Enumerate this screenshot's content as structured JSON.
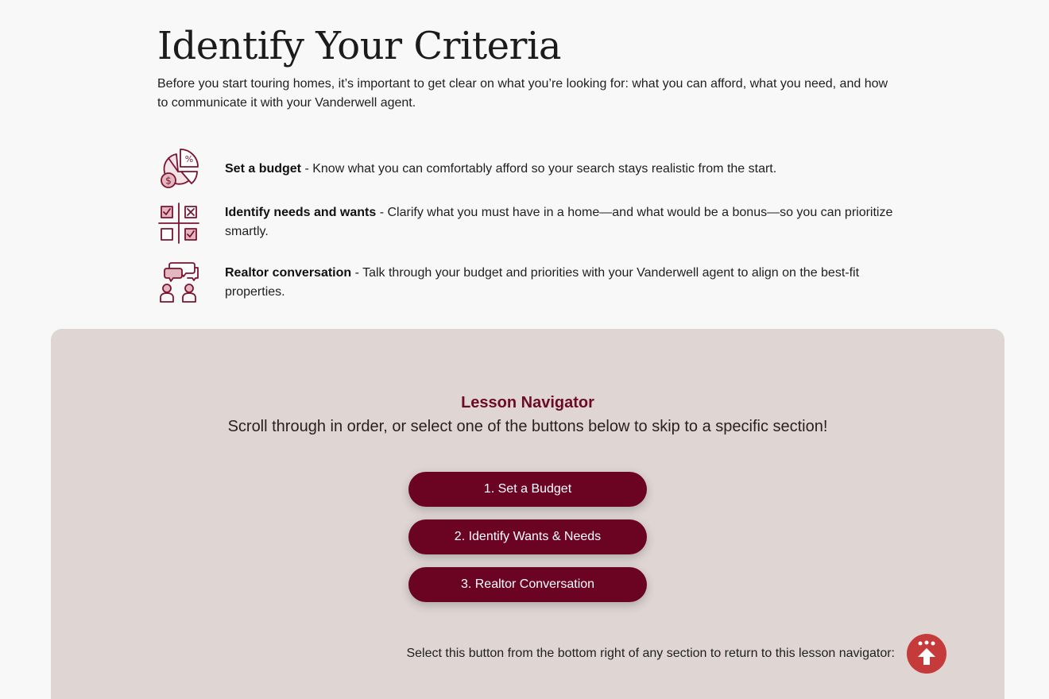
{
  "header": {
    "title": "Identify Your Criteria",
    "intro": "Before you start touring homes, it’s important to get clear on what you’re looking for: what you can afford, what you need, and how to communicate it with your Vanderwell agent."
  },
  "criteria": [
    {
      "icon": "budget-pie-chart-icon",
      "title": "Set a budget",
      "description": " - Know what you can comfortably afford so your search stays realistic from the start."
    },
    {
      "icon": "needs-wants-checklist-icon",
      "title": "Identify needs and wants",
      "description": " - Clarify what you must have in a home—and what would be a bonus—so you can prioritize smartly."
    },
    {
      "icon": "conversation-people-icon",
      "title": "Realtor conversation",
      "description": " - Talk through your budget and priorities with your Vanderwell agent to align on the best-fit properties."
    }
  ],
  "navigator": {
    "title": "Lesson Navigator",
    "subtitle": "Scroll through in order, or select one of the buttons below to skip to a specific section!",
    "buttons": [
      "1. Set a Budget",
      "2. Identify Wants & Needs",
      "3. Realtor Conversation"
    ],
    "return_note": "Select this button from the bottom right of any section to return to this lesson navigator:",
    "return_icon": "return-to-navigator-arrow-icon"
  },
  "colors": {
    "accent": "#6b0422",
    "accent_title": "#6b0b25",
    "panel_bg": "#dfd6d4",
    "return_button": "#c53b3b",
    "icon_stroke": "#7a1430",
    "icon_fill": "#e3b7bf"
  }
}
